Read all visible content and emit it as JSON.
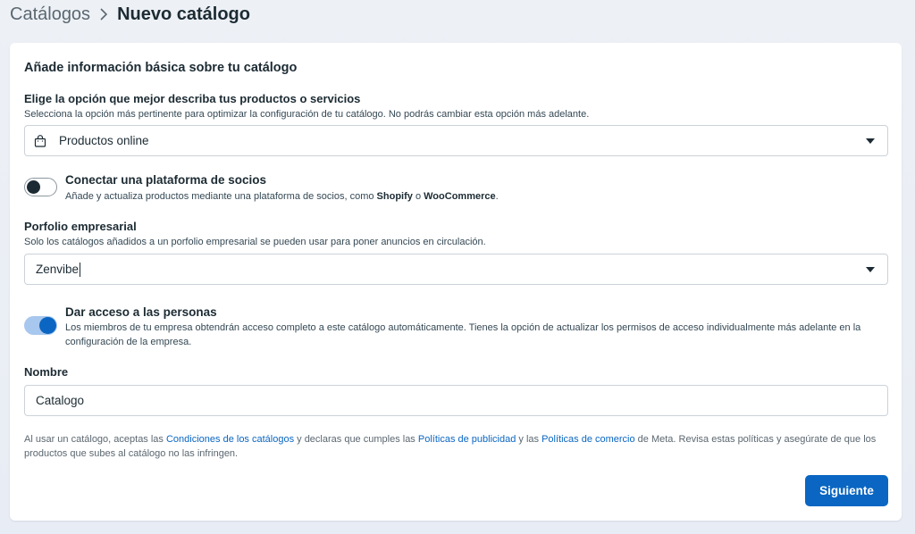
{
  "breadcrumb": {
    "parent": "Catálogos",
    "current": "Nuevo catálogo"
  },
  "card": {
    "title": "Añade información básica sobre tu catálogo",
    "product_type": {
      "label": "Elige la opción que mejor describa tus productos o servicios",
      "help": "Selecciona la opción más pertinente para optimizar la configuración de tu catálogo. No podrás cambiar esta opción más adelante.",
      "value": "Productos online",
      "icon": "shopping-bag-icon"
    },
    "partner_platform": {
      "title": "Conectar una plataforma de socios",
      "desc_prefix": "Añade y actualiza productos mediante una plataforma de socios, como ",
      "partner1": "Shopify",
      "desc_mid": " o ",
      "partner2": "WooCommerce",
      "desc_suffix": ".",
      "enabled": false
    },
    "business_portfolio": {
      "label": "Porfolio empresarial",
      "help": "Solo los catálogos añadidos a un porfolio empresarial se pueden usar para poner anuncios en circulación.",
      "value": "Zenvibe"
    },
    "people_access": {
      "title": "Dar acceso a las personas",
      "desc": "Los miembros de tu empresa obtendrán acceso completo a este catálogo automáticamente. Tienes la opción de actualizar los permisos de acceso individualmente más adelante en la configuración de la empresa.",
      "enabled": true
    },
    "name": {
      "label": "Nombre",
      "value": "Catalogo"
    },
    "footer": {
      "t1": "Al usar un catálogo, aceptas las ",
      "link1": "Condiciones de los catálogos",
      "t2": " y declaras que cumples las ",
      "link2": "Políticas de publicidad",
      "t3": " y las ",
      "link3": "Políticas de comercio",
      "t4": " de Meta. Revisa estas políticas y asegúrate de que los productos que subes al catálogo no las infringen."
    },
    "next_button": "Siguiente"
  },
  "colors": {
    "accent": "#0a66c2",
    "text": "#1c2b33",
    "link": "#0a66c2"
  }
}
